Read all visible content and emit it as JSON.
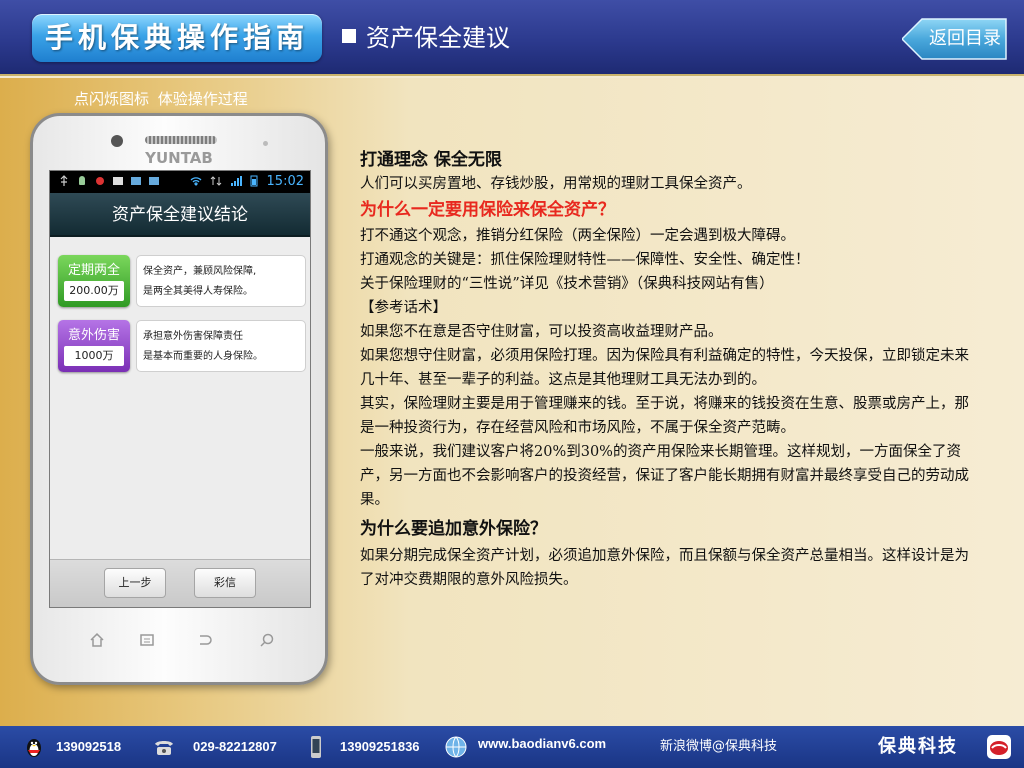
{
  "header": {
    "logo_text": "手机保典操作指南",
    "section_title": "资产保全建议",
    "back_label": "返回目录"
  },
  "hint": "点闪烁图标   体验操作过程",
  "phone": {
    "brand": "YUNTAB",
    "time": "15:02",
    "app_title": "资产保全建议结论",
    "cards": [
      {
        "badge_title": "定期两全",
        "badge_value": "200.00万",
        "line1": "保全资产，兼顾风险保障,",
        "line2": "是两全其美得人寿保险。",
        "color": "#3aa52b"
      },
      {
        "badge_title": "意外伤害",
        "badge_value": "1000万",
        "line1": "承担意外伤害保障责任",
        "line2": "是基本而重要的人身保险。",
        "color": "#8a3cc4"
      }
    ],
    "buttons": {
      "prev": "上一步",
      "sms": "彩信"
    }
  },
  "article": {
    "h1": "打通理念 保全无限",
    "p1": "人们可以买房置地、存钱炒股，用常规的理财工具保全资产。",
    "q1": "为什么一定要用保险来保全资产？",
    "p2": "打不通这个观念，推销分红保险（两全保险）一定会遇到极大障碍。",
    "p3": "打通观念的关键是：抓住保险理财特性——保障性、安全性、确定性！",
    "p4": "关于保险理财的“三性说”详见《技术营销》（保典科技网站有售）",
    "p5": "【参考话术】",
    "p6": "如果您不在意是否守住财富，可以投资高收益理财产品。",
    "p7": "如果您想守住财富，必须用保险打理。因为保险具有利益确定的特性，今天投保，立即锁定未来几十年、甚至一辈子的利益。这点是其他理财工具无法办到的。",
    "p8": "其实，保险理财主要是用于管理赚来的钱。至于说，将赚来的钱投资在生意、股票或房产上，那是一种投资行为，存在经营风险和市场风险，不属于保全资产范畴。",
    "p9": "一般来说，我们建议客户将20%到30%的资产用保险来长期管理。这样规划，一方面保全了资产，另一方面也不会影响客户的投资经营，保证了客户能长期拥有财富并最终享受自己的劳动成果。",
    "h2": "为什么要追加意外保险？",
    "p10": "如果分期完成保全资产计划，必须追加意外保险，而且保额与保全资产总量相当。这样设计是为了对冲交费期限的意外风险损失。"
  },
  "footer": {
    "qq": "139092518",
    "phone": "029-82212807",
    "mobile": "13909251836",
    "website": "www.baodianv6.com",
    "weibo": "新浪微博@保典科技",
    "brand": "保典科技"
  }
}
